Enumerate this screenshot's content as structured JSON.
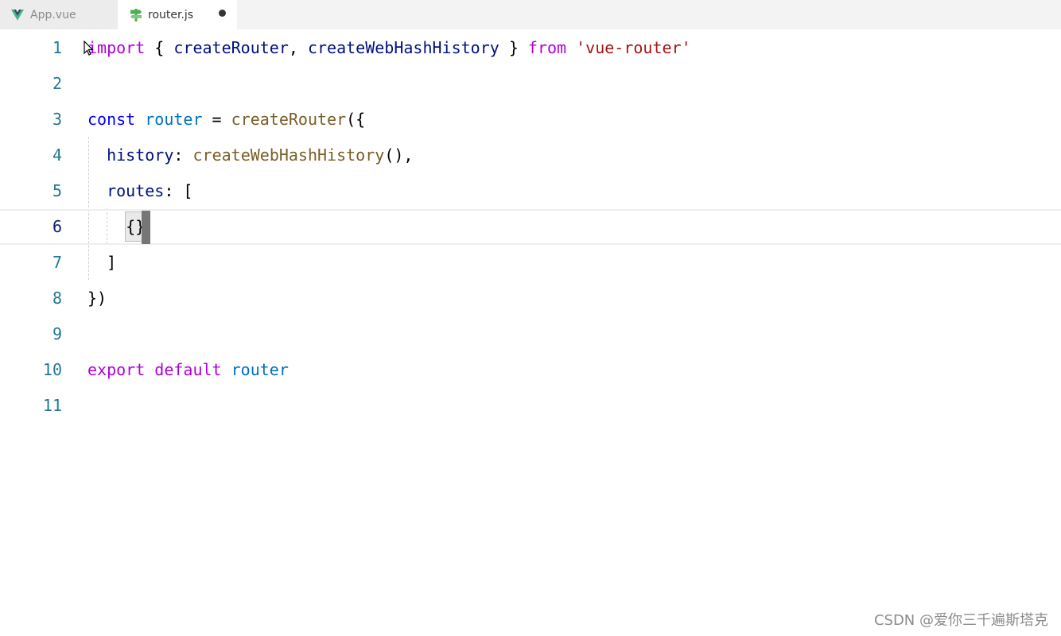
{
  "tabs": [
    {
      "label": "App.vue",
      "icon": "vue-icon",
      "active": false
    },
    {
      "label": "router.js",
      "icon": "router-icon",
      "active": true,
      "unsaved": true
    }
  ],
  "editor": {
    "current_line": 6,
    "lines": [
      {
        "number": "1",
        "tokens": [
          {
            "t": "import",
            "c": "kw"
          },
          {
            "t": " { ",
            "c": "punc"
          },
          {
            "t": "createRouter",
            "c": "var"
          },
          {
            "t": ", ",
            "c": "punc"
          },
          {
            "t": "createWebHashHistory",
            "c": "var"
          },
          {
            "t": " } ",
            "c": "punc"
          },
          {
            "t": "from",
            "c": "kw"
          },
          {
            "t": " ",
            "c": "punc"
          },
          {
            "t": "'vue-router'",
            "c": "str"
          }
        ]
      },
      {
        "number": "2",
        "tokens": []
      },
      {
        "number": "3",
        "tokens": [
          {
            "t": "const",
            "c": "decl"
          },
          {
            "t": " ",
            "c": "punc"
          },
          {
            "t": "router",
            "c": "cnst"
          },
          {
            "t": " = ",
            "c": "punc"
          },
          {
            "t": "createRouter",
            "c": "fn"
          },
          {
            "t": "({",
            "c": "punc"
          }
        ]
      },
      {
        "number": "4",
        "tokens": [
          {
            "t": "  ",
            "c": "punc"
          },
          {
            "t": "history",
            "c": "prop"
          },
          {
            "t": ": ",
            "c": "punc"
          },
          {
            "t": "createWebHashHistory",
            "c": "fn"
          },
          {
            "t": "(),",
            "c": "punc"
          }
        ]
      },
      {
        "number": "5",
        "tokens": [
          {
            "t": "  ",
            "c": "punc"
          },
          {
            "t": "routes",
            "c": "prop"
          },
          {
            "t": ": [",
            "c": "punc"
          }
        ]
      },
      {
        "number": "6",
        "tokens": [
          {
            "t": "    ",
            "c": "punc"
          },
          {
            "t": "{}",
            "c": "bracket"
          }
        ]
      },
      {
        "number": "7",
        "tokens": [
          {
            "t": "  ]",
            "c": "punc"
          }
        ]
      },
      {
        "number": "8",
        "tokens": [
          {
            "t": "})",
            "c": "punc"
          }
        ]
      },
      {
        "number": "9",
        "tokens": []
      },
      {
        "number": "10",
        "tokens": [
          {
            "t": "export",
            "c": "kw"
          },
          {
            "t": " ",
            "c": "punc"
          },
          {
            "t": "default",
            "c": "kw"
          },
          {
            "t": " ",
            "c": "punc"
          },
          {
            "t": "router",
            "c": "cnst"
          }
        ]
      },
      {
        "number": "11",
        "tokens": []
      }
    ]
  },
  "watermark": "CSDN @爱你三千遍斯塔克",
  "colors": {
    "keyword": "#af00db",
    "declaration": "#0000ff",
    "variable": "#001080",
    "function": "#795e26",
    "string": "#a31515",
    "constant": "#0070c1",
    "line_number": "#237893"
  }
}
